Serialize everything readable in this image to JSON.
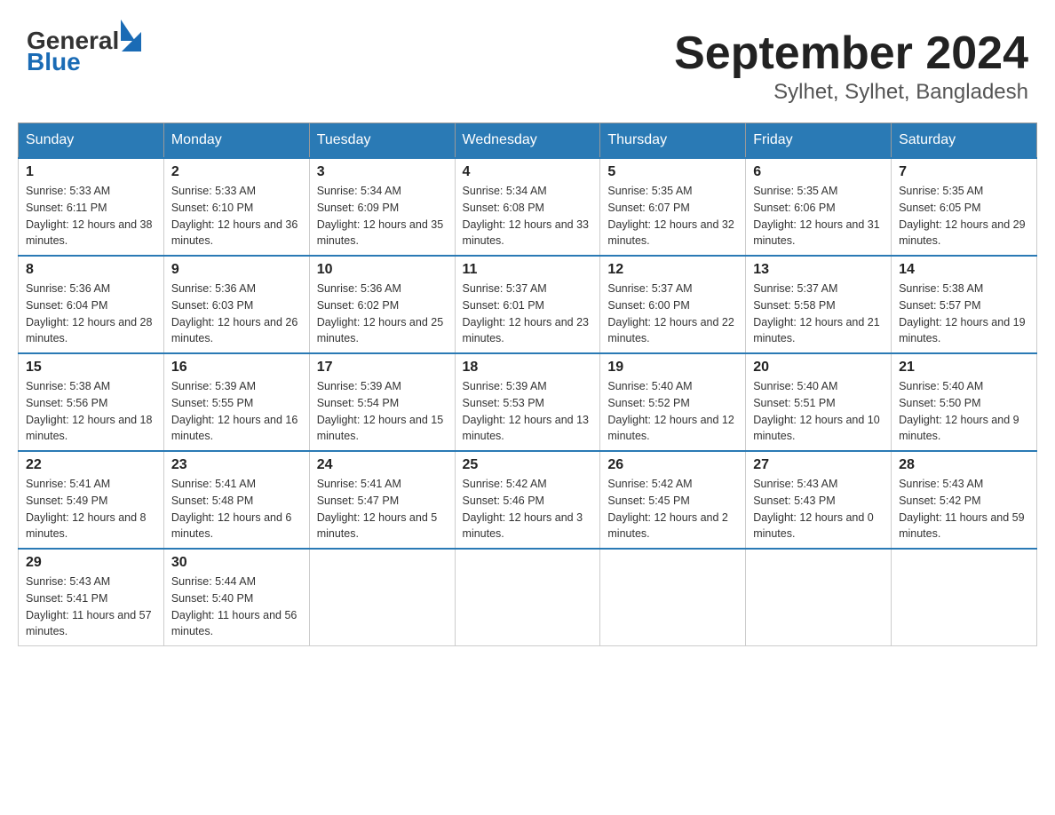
{
  "header": {
    "logo_general": "General",
    "logo_blue": "Blue",
    "month_year": "September 2024",
    "location": "Sylhet, Sylhet, Bangladesh"
  },
  "days_of_week": [
    "Sunday",
    "Monday",
    "Tuesday",
    "Wednesday",
    "Thursday",
    "Friday",
    "Saturday"
  ],
  "weeks": [
    [
      {
        "day": "1",
        "sunrise": "5:33 AM",
        "sunset": "6:11 PM",
        "daylight": "12 hours and 38 minutes."
      },
      {
        "day": "2",
        "sunrise": "5:33 AM",
        "sunset": "6:10 PM",
        "daylight": "12 hours and 36 minutes."
      },
      {
        "day": "3",
        "sunrise": "5:34 AM",
        "sunset": "6:09 PM",
        "daylight": "12 hours and 35 minutes."
      },
      {
        "day": "4",
        "sunrise": "5:34 AM",
        "sunset": "6:08 PM",
        "daylight": "12 hours and 33 minutes."
      },
      {
        "day": "5",
        "sunrise": "5:35 AM",
        "sunset": "6:07 PM",
        "daylight": "12 hours and 32 minutes."
      },
      {
        "day": "6",
        "sunrise": "5:35 AM",
        "sunset": "6:06 PM",
        "daylight": "12 hours and 31 minutes."
      },
      {
        "day": "7",
        "sunrise": "5:35 AM",
        "sunset": "6:05 PM",
        "daylight": "12 hours and 29 minutes."
      }
    ],
    [
      {
        "day": "8",
        "sunrise": "5:36 AM",
        "sunset": "6:04 PM",
        "daylight": "12 hours and 28 minutes."
      },
      {
        "day": "9",
        "sunrise": "5:36 AM",
        "sunset": "6:03 PM",
        "daylight": "12 hours and 26 minutes."
      },
      {
        "day": "10",
        "sunrise": "5:36 AM",
        "sunset": "6:02 PM",
        "daylight": "12 hours and 25 minutes."
      },
      {
        "day": "11",
        "sunrise": "5:37 AM",
        "sunset": "6:01 PM",
        "daylight": "12 hours and 23 minutes."
      },
      {
        "day": "12",
        "sunrise": "5:37 AM",
        "sunset": "6:00 PM",
        "daylight": "12 hours and 22 minutes."
      },
      {
        "day": "13",
        "sunrise": "5:37 AM",
        "sunset": "5:58 PM",
        "daylight": "12 hours and 21 minutes."
      },
      {
        "day": "14",
        "sunrise": "5:38 AM",
        "sunset": "5:57 PM",
        "daylight": "12 hours and 19 minutes."
      }
    ],
    [
      {
        "day": "15",
        "sunrise": "5:38 AM",
        "sunset": "5:56 PM",
        "daylight": "12 hours and 18 minutes."
      },
      {
        "day": "16",
        "sunrise": "5:39 AM",
        "sunset": "5:55 PM",
        "daylight": "12 hours and 16 minutes."
      },
      {
        "day": "17",
        "sunrise": "5:39 AM",
        "sunset": "5:54 PM",
        "daylight": "12 hours and 15 minutes."
      },
      {
        "day": "18",
        "sunrise": "5:39 AM",
        "sunset": "5:53 PM",
        "daylight": "12 hours and 13 minutes."
      },
      {
        "day": "19",
        "sunrise": "5:40 AM",
        "sunset": "5:52 PM",
        "daylight": "12 hours and 12 minutes."
      },
      {
        "day": "20",
        "sunrise": "5:40 AM",
        "sunset": "5:51 PM",
        "daylight": "12 hours and 10 minutes."
      },
      {
        "day": "21",
        "sunrise": "5:40 AM",
        "sunset": "5:50 PM",
        "daylight": "12 hours and 9 minutes."
      }
    ],
    [
      {
        "day": "22",
        "sunrise": "5:41 AM",
        "sunset": "5:49 PM",
        "daylight": "12 hours and 8 minutes."
      },
      {
        "day": "23",
        "sunrise": "5:41 AM",
        "sunset": "5:48 PM",
        "daylight": "12 hours and 6 minutes."
      },
      {
        "day": "24",
        "sunrise": "5:41 AM",
        "sunset": "5:47 PM",
        "daylight": "12 hours and 5 minutes."
      },
      {
        "day": "25",
        "sunrise": "5:42 AM",
        "sunset": "5:46 PM",
        "daylight": "12 hours and 3 minutes."
      },
      {
        "day": "26",
        "sunrise": "5:42 AM",
        "sunset": "5:45 PM",
        "daylight": "12 hours and 2 minutes."
      },
      {
        "day": "27",
        "sunrise": "5:43 AM",
        "sunset": "5:43 PM",
        "daylight": "12 hours and 0 minutes."
      },
      {
        "day": "28",
        "sunrise": "5:43 AM",
        "sunset": "5:42 PM",
        "daylight": "11 hours and 59 minutes."
      }
    ],
    [
      {
        "day": "29",
        "sunrise": "5:43 AM",
        "sunset": "5:41 PM",
        "daylight": "11 hours and 57 minutes."
      },
      {
        "day": "30",
        "sunrise": "5:44 AM",
        "sunset": "5:40 PM",
        "daylight": "11 hours and 56 minutes."
      },
      null,
      null,
      null,
      null,
      null
    ]
  ],
  "labels": {
    "sunrise": "Sunrise:",
    "sunset": "Sunset:",
    "daylight": "Daylight:"
  }
}
